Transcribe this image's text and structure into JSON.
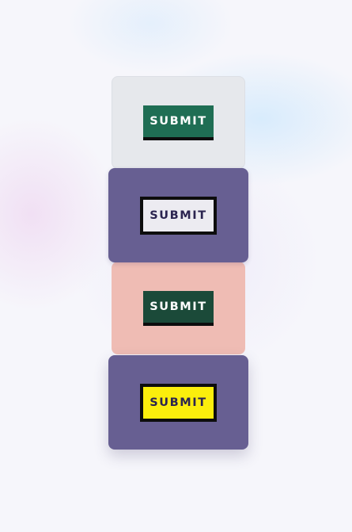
{
  "cards": [
    {
      "button_label": "SUBMIT",
      "card_color": "#e6e8ec",
      "button_color": "#1f6e54",
      "button_text_color": "#ffffff"
    },
    {
      "button_label": "SUBMIT",
      "card_color": "#675f92",
      "button_color": "#ecebf1",
      "button_text_color": "#2b2450"
    },
    {
      "button_label": "SUBMIT",
      "card_color": "#efbcb4",
      "button_color": "#1b4a39",
      "button_text_color": "#ffffff"
    },
    {
      "button_label": "SUBMIT",
      "card_color": "#675f92",
      "button_color": "#fbee0c",
      "button_text_color": "#2b2450"
    }
  ]
}
